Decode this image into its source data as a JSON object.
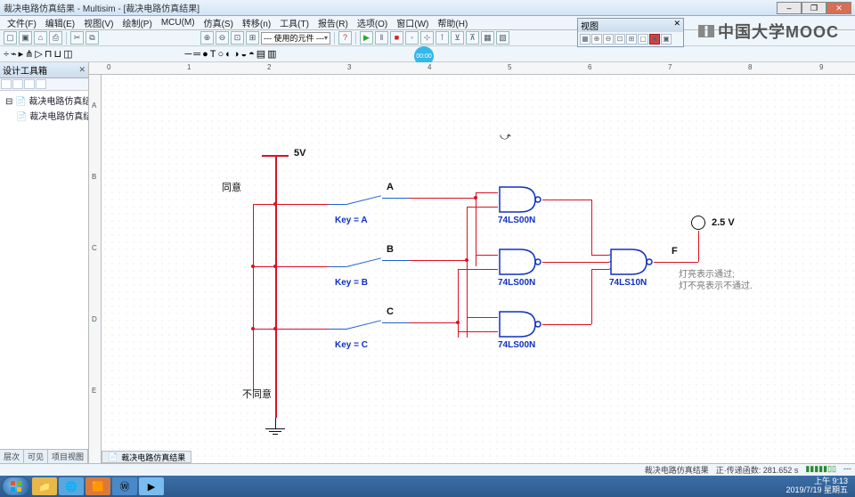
{
  "window": {
    "title": "裁决电路仿真结果 - Multisim - [裁决电路仿真结果]"
  },
  "menu": {
    "file": "文件(F)",
    "edit": "编辑(E)",
    "view": "视图(V)",
    "place": "绘制(P)",
    "mcu": "MCU(M)",
    "simulate": "仿真(S)",
    "transfer": "转移(n)",
    "tools": "工具(T)",
    "reports": "报告(R)",
    "options": "选项(O)",
    "window": "窗口(W)",
    "help": "帮助(H)"
  },
  "toolbar": {
    "component_combo": "--- 使用的元件 ---"
  },
  "timestamp_badge": "00:00",
  "float_panel": {
    "title": "视图"
  },
  "left_panel": {
    "title": "设计工具箱",
    "tree_root": "裁决电路仿真结果",
    "tree_child": "裁决电路仿真结果",
    "tabs": [
      "层次",
      "可见",
      "项目视图"
    ]
  },
  "ruler_h": [
    "0",
    "1",
    "2",
    "3",
    "4",
    "5",
    "6",
    "7",
    "8",
    "9"
  ],
  "ruler_v": [
    "A",
    "B",
    "C",
    "D",
    "E"
  ],
  "schematic": {
    "vcc": "5V",
    "agree": "同意",
    "disagree": "不同意",
    "sw_a": "A",
    "key_a": "Key = A",
    "sw_b": "B",
    "key_b": "Key = B",
    "sw_c": "C",
    "key_c": "Key = C",
    "gate1": "74LS00N",
    "gate2": "74LS00N",
    "gate3": "74LS00N",
    "gate4": "74LS10N",
    "out": "F",
    "probe_v": "2.5 V",
    "note1": "灯亮表示通过;",
    "note2": "灯不亮表示不通过."
  },
  "bottom_tab": "裁决电路仿真结果",
  "status": {
    "file": "裁决电路仿真结果",
    "sim": "正·传递函数: 281.652 s",
    "extra": "---"
  },
  "watermark": "中国大学MOOC",
  "taskbar": {
    "time": "上午 9:13",
    "date": "2019/7/19 星期五"
  }
}
